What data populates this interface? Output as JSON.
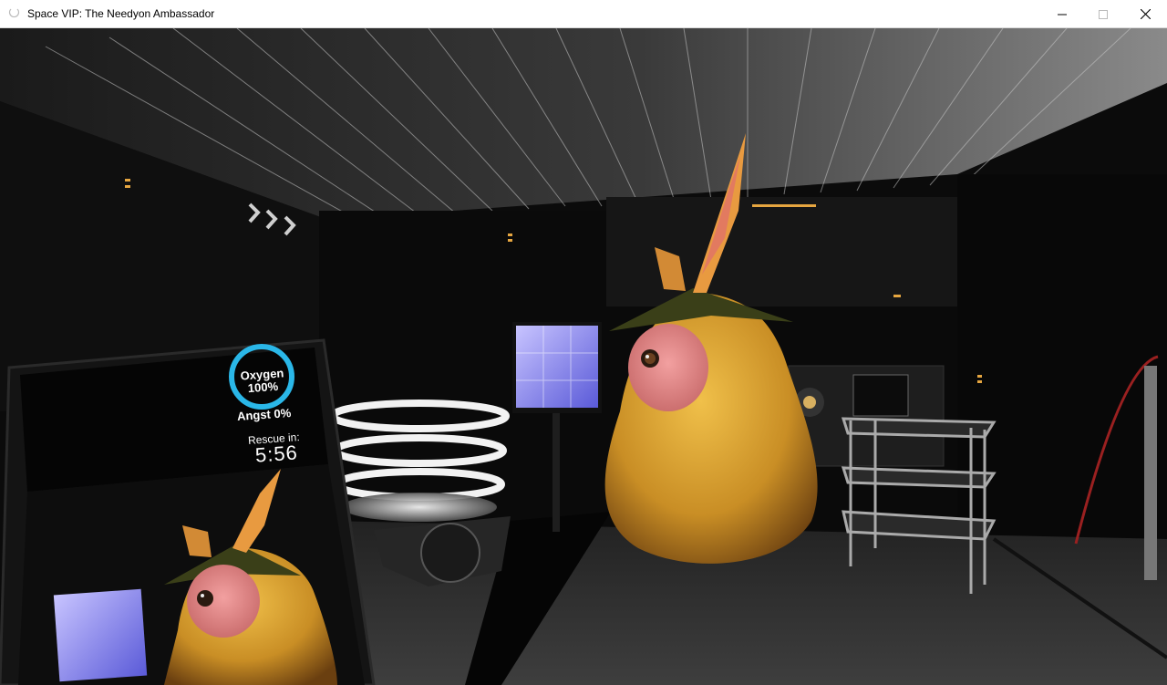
{
  "window": {
    "title": "Space VIP: The Needyon Ambassador",
    "controls": [
      "minimize-icon",
      "maximize-icon",
      "close-icon"
    ]
  },
  "hud": {
    "oxygen_label": "Oxygen",
    "oxygen_value": "100%",
    "oxygen_ring_color": "#2ab7e8",
    "angst_text": "Angst 0%",
    "rescue_label": "Rescue in:",
    "rescue_timer": "5:56"
  },
  "scene": {
    "description_icons": [
      "chevron-arrows-icon",
      "alien-needyon",
      "monitor-screen",
      "teleporter-pad",
      "metal-rack"
    ],
    "colors": {
      "alien_body": "#d6a030",
      "alien_cheek": "#e08888",
      "screen_glow": "#8a7cff",
      "teleporter_ring": "#f2f2f2"
    }
  }
}
